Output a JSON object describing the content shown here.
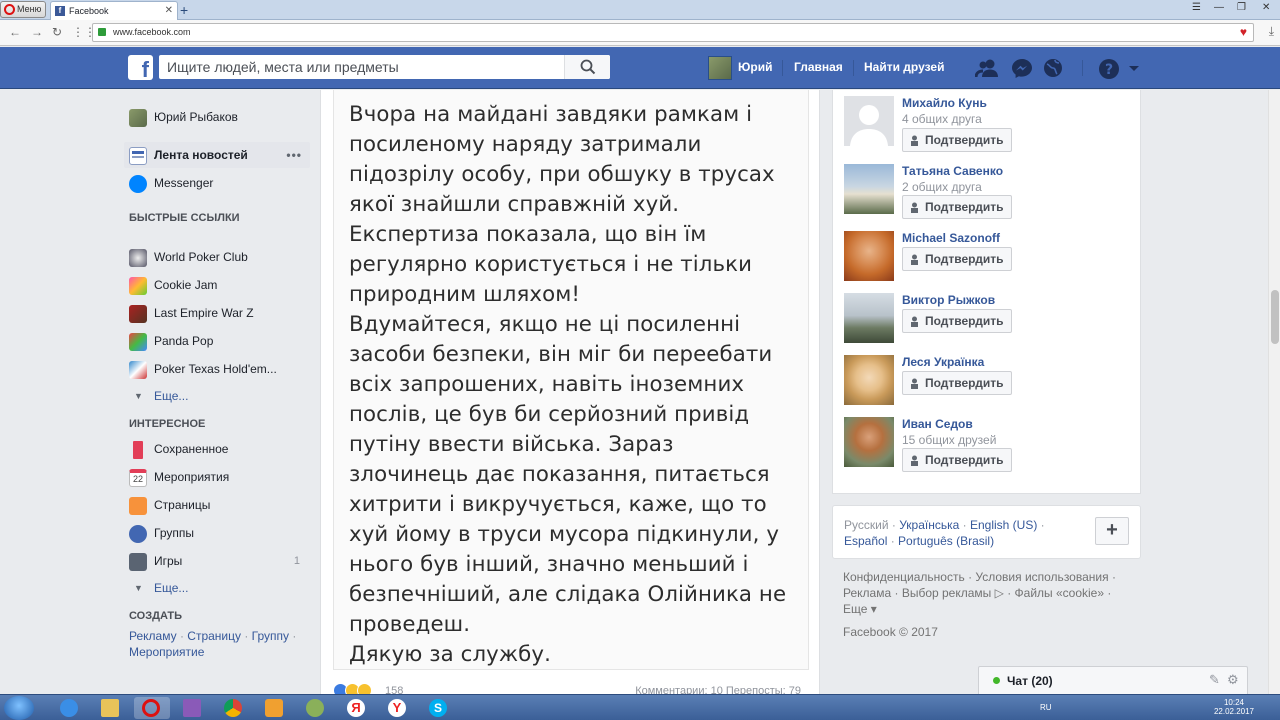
{
  "browser": {
    "menu_label": "Меню",
    "tab_title": "Facebook",
    "url": "www.facebook.com"
  },
  "header": {
    "search_placeholder": "Ищите людей, места или предметы",
    "user_name": "Юрий",
    "home": "Главная",
    "find_friends": "Найти друзей"
  },
  "sidebar": {
    "profile": "Юрий Рыбаков",
    "news_feed": "Лента новостей",
    "messenger": "Messenger",
    "shortcuts_title": "БЫСТРЫЕ ССЫЛКИ",
    "shortcuts": [
      "World Poker Club",
      "Cookie Jam",
      "Last Empire War Z",
      "Panda Pop",
      "Poker Texas Hold'em..."
    ],
    "more": "Еще...",
    "explore_title": "ИНТЕРЕСНОЕ",
    "explore": [
      {
        "label": "Сохраненное",
        "count": ""
      },
      {
        "label": "Мероприятия",
        "count": ""
      },
      {
        "label": "Страницы",
        "count": ""
      },
      {
        "label": "Группы",
        "count": ""
      },
      {
        "label": "Игры",
        "count": "1"
      }
    ],
    "calendar_day": "22",
    "create_title": "СОЗДАТЬ",
    "create_links": [
      "Рекламу",
      "Страницу",
      "Группу",
      "Мероприятие"
    ]
  },
  "post": {
    "text": "Вчора на майдані завдяки рамкам і\nпосиленому наряду затримали\nпідозрілу особу, при обшуку в трусах\nякої знайшли справжній хуй.\nЕкспертиза показала, що він їм\nрегулярно користується і не тільки\nприродним шляхом!\nВдумайтеся, якщо не ці посиленні\nзасоби безпеки,  він міг би переебати\nвсіх запрошених, навіть іноземних\nпослів, це був би серйозний привід\nпутіну ввести війська.  Зараз\nзлочинець дає показання, питається\nхитрити і викручується, каже, що то\nхуй йому в труси  мусора підкинули, у\nнього був інший, значно меньший і\nбезпечніший, але слідака Олійника не\nпроведеш.\nДякую за службу.",
    "reaction_count": "158",
    "comments_shares": "Комментарии: 10  Перепосты: 79"
  },
  "friend_requests": [
    {
      "name": "Михайло Кунь",
      "mutual": "4 общих друга"
    },
    {
      "name": "Татьяна Савенко",
      "mutual": "2 общих друга"
    },
    {
      "name": "Michael Sazonoff",
      "mutual": ""
    },
    {
      "name": "Виктор Рыжков",
      "mutual": ""
    },
    {
      "name": "Леся Українка",
      "mutual": ""
    },
    {
      "name": "Иван Седов",
      "mutual": "15 общих друзей"
    }
  ],
  "confirm_label": "Подтвердить",
  "languages": {
    "current": "Русский",
    "others": [
      "Українська",
      "English (US)",
      "Español",
      "Português (Brasil)"
    ]
  },
  "footer": {
    "links": [
      "Конфиденциальность",
      "Условия использования",
      "Реклама",
      "Выбор рекламы",
      "Файлы «cookie»",
      "Еще"
    ],
    "copyright": "Facebook © 2017"
  },
  "chat": {
    "label": "Чат (20)"
  },
  "taskbar": {
    "lang": "RU",
    "time": "10:24",
    "date": "22.02.2017"
  },
  "colors": {
    "fb_blue": "#4267b2",
    "link": "#365899",
    "online": "#42b72a"
  }
}
